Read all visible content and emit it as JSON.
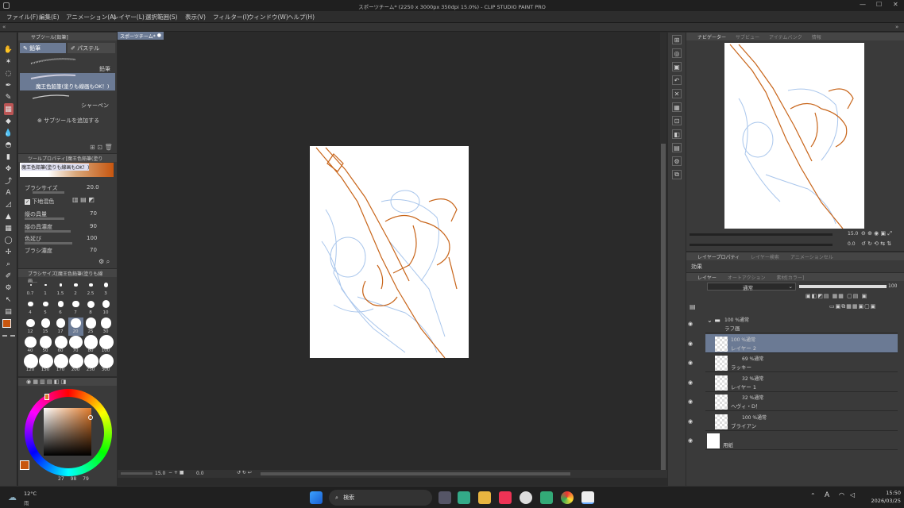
{
  "window": {
    "title": "スポーツチーム* (2250 x 3000px 350dpi 15.0%) - CLIP STUDIO PAINT PRO",
    "controls": [
      "—",
      "☐",
      "✕"
    ]
  },
  "menu": [
    "ファイル(F)",
    "編集(E)",
    "アニメーション(A)",
    "レイヤー(L)",
    "選択範囲(S)",
    "表示(V)",
    "フィルター(I)",
    "ウィンドウ(W)",
    "ヘルプ(H)"
  ],
  "subtool": {
    "header": "サブツール[鉛筆]",
    "tabs": [
      "鉛筆",
      "パステル"
    ],
    "items": [
      "鉛筆",
      "魔王色鉛筆(塗りも線画もOK！)",
      "シャーペン"
    ],
    "add_label": "サブツールを追加する"
  },
  "tool_property": {
    "header": "ツールプロパティ[魔王色鉛筆(塗りも線画…",
    "preview_name": "魔王色鉛筆(塗りも線画もOK！)",
    "props": [
      {
        "label": "ブラシサイズ",
        "value": "20.0"
      },
      {
        "label": "下地混色",
        "value": ""
      },
      {
        "label": "縦の具量",
        "value": "70"
      },
      {
        "label": "縦の具濃度",
        "value": "90"
      },
      {
        "label": "色延び",
        "value": "100"
      },
      {
        "label": "ブラシ濃度",
        "value": "70"
      }
    ]
  },
  "brush_size": {
    "header": "ブラシサイズ[魔王色鉛筆(塗りも線画…",
    "sizes": [
      "0.7",
      "1",
      "1.5",
      "2",
      "2.5",
      "3",
      "4",
      "5",
      "6",
      "7",
      "8",
      "10",
      "12",
      "15",
      "17",
      "20",
      "25",
      "30",
      "40",
      "50",
      "60",
      "70",
      "80",
      "100",
      "120",
      "150",
      "170",
      "200",
      "250",
      "300"
    ]
  },
  "color": {
    "main": "#c8560f",
    "values": [
      "27",
      "98",
      "79"
    ],
    "accent": "#e07a2a"
  },
  "canvas": {
    "tab": "スポーツチーム*",
    "zoom": "15.0",
    "angle": "0.0"
  },
  "navigator": {
    "tabs": [
      "ナビゲーター",
      "サブビュー",
      "アイテムバンク",
      "情報"
    ],
    "zoom": "15.0",
    "angle": "0.0"
  },
  "layer_property": {
    "tabs": [
      "レイヤープロパティ",
      "レイヤー検索",
      "アニメーションセル"
    ],
    "effect_label": "効果"
  },
  "layers": {
    "tabs": [
      "レイヤー",
      "オートアクション",
      "素材[カラー]"
    ],
    "blend_mode": "通常",
    "opacity": "100",
    "items": [
      {
        "opacity": "100 %通常",
        "name": "ラフ画",
        "type": "folder"
      },
      {
        "opacity": "100 %通常",
        "name": "レイヤー 2",
        "selected": true
      },
      {
        "opacity": "69 %通常",
        "name": "ラッキー"
      },
      {
        "opacity": "32 %通常",
        "name": "レイヤー 1"
      },
      {
        "opacity": "32 %通常",
        "name": "ヘヴィ・D！"
      },
      {
        "opacity": "100 %通常",
        "name": "ブライアン"
      },
      {
        "opacity": "",
        "name": "用紙",
        "type": "paper"
      }
    ]
  },
  "taskbar": {
    "weather_temp": "12°C",
    "weather_label": "雨",
    "search": "検索",
    "ime": "A",
    "time": "15:50",
    "date": "2026/03/25"
  }
}
